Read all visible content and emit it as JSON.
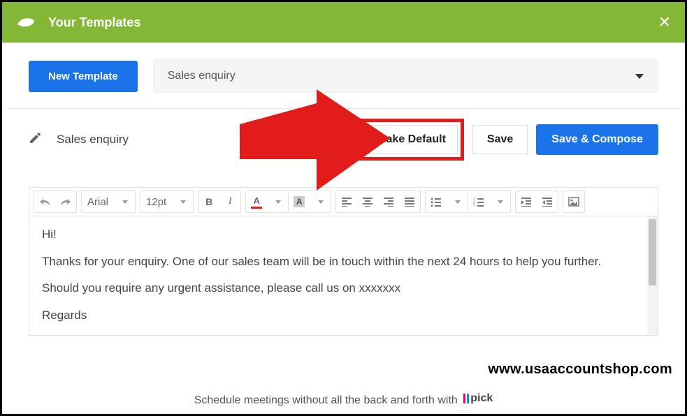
{
  "header": {
    "title": "Your Templates"
  },
  "top": {
    "new_template_label": "New Template",
    "dropdown_value": "Sales enquiry"
  },
  "actions": {
    "template_name": "Sales enquiry",
    "make_default_label": "Make Default",
    "save_label": "Save",
    "save_compose_label": "Save & Compose"
  },
  "toolbar": {
    "font_family": "Arial",
    "font_size": "12pt"
  },
  "body": {
    "line1": "Hi!",
    "line2": "Thanks for your enquiry. One of our sales team will be in touch within the next 24 hours to help you further.",
    "line3": "Should you require any urgent assistance, please call us on xxxxxxx",
    "line4": "Regards"
  },
  "footer": {
    "text": "Schedule meetings without all the back and forth with ",
    "brand": "pick"
  },
  "watermark": "www.usaaccountshop.com"
}
